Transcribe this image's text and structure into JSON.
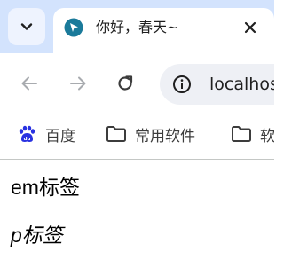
{
  "tab": {
    "title": "你好，春天~"
  },
  "omnibox": {
    "url": "localhost"
  },
  "bookmarks": [
    {
      "label": "百度",
      "icon": "baidu-icon"
    },
    {
      "label": "常用软件",
      "icon": "folder-icon"
    },
    {
      "label": "软",
      "icon": "folder-icon"
    }
  ],
  "page": {
    "em_label": "em标签",
    "p_label": "p标签"
  },
  "colors": {
    "tabstrip": "#d3e3fd",
    "favicon": "#1a7a9a",
    "baidu_blue": "#2932e1"
  }
}
